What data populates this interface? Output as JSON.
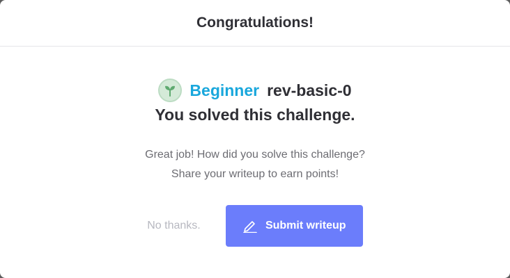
{
  "modal": {
    "title": "Congratulations!"
  },
  "challenge": {
    "level_icon": "seedling-icon",
    "level": "Beginner",
    "name": "rev-basic-0",
    "solved_text": "You solved this challenge."
  },
  "message": {
    "line1": "Great job! How did you solve this challenge?",
    "line2": "Share your writeup to earn points!"
  },
  "actions": {
    "no_thanks_label": "No thanks.",
    "submit_label": "Submit writeup",
    "submit_icon": "pencil-icon"
  },
  "colors": {
    "level_accent": "#19a7dc",
    "primary_button": "#6b7dfb",
    "badge_bg": "#d4ead8"
  }
}
